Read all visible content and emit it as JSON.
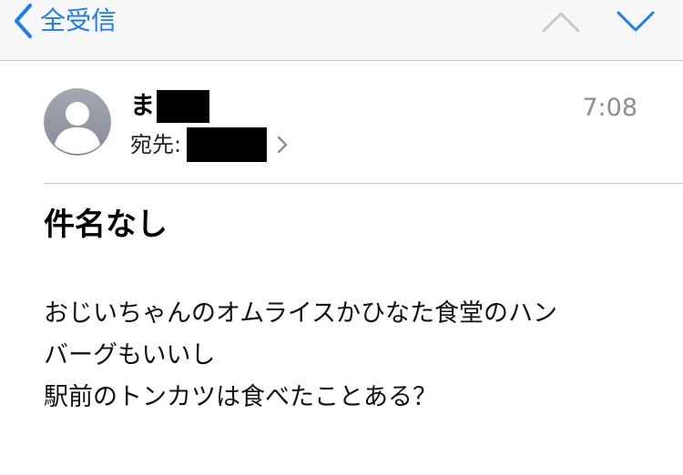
{
  "nav": {
    "back_label": "全受信",
    "accent_color": "#1e7cf2",
    "up_icon": "chevron-up-icon",
    "down_icon": "chevron-down-icon"
  },
  "message": {
    "sender_name_visible": "ま",
    "time": "7:08",
    "to_label": "宛先:",
    "subject": "件名なし",
    "body_lines": [
      "おじいちゃんのオムライスかひなた食堂のハン",
      "バーグもいいし",
      "駅前のトンカツは食べたことある？"
    ]
  }
}
